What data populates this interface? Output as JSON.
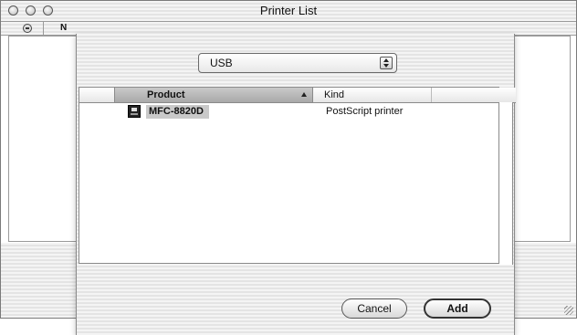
{
  "window": {
    "title": "Printer List",
    "column_header_fragment": "N"
  },
  "sheet": {
    "connection_select": {
      "value": "USB"
    },
    "table": {
      "columns": [
        "Product",
        "Kind"
      ],
      "rows": [
        {
          "product": "MFC-8820D",
          "kind": "PostScript printer",
          "selected": true
        }
      ]
    },
    "buttons": {
      "cancel": "Cancel",
      "add": "Add"
    }
  },
  "icons": {
    "window_controls": [
      "close-icon",
      "minimize-icon",
      "zoom-icon"
    ],
    "column_toggle": "minus-circle-icon",
    "sort": "sort-ascending-icon",
    "printer": "printer-icon",
    "select": "popup-arrows-icon",
    "resize": "resize-grip-icon"
  }
}
